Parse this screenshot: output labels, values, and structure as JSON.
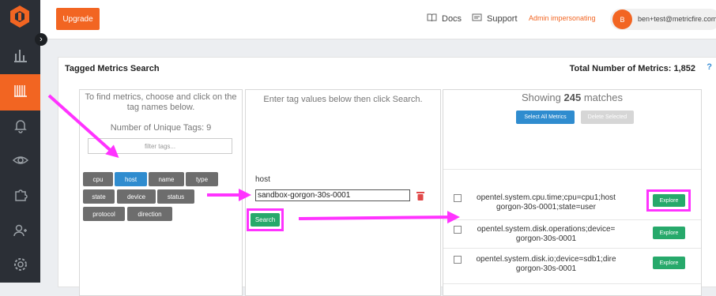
{
  "topbar": {
    "upgrade_label": "Upgrade",
    "docs_label": "Docs",
    "support_label": "Support",
    "impersonating_label": "Admin impersonating",
    "avatar_initial": "B",
    "email": "ben+test@metricfire.com"
  },
  "sidebar": {
    "items": [
      "logo-icon",
      "bar-chart-icon",
      "metrics-icon",
      "bell-icon",
      "eye-icon",
      "puzzle-icon",
      "users-icon",
      "gear-icon"
    ],
    "active_index": 2
  },
  "page": {
    "title": "Tagged Metrics Search",
    "total_label": "Total Number of Metrics: 1,852",
    "help": "?"
  },
  "tags_panel": {
    "instruction_line1": "To find metrics, choose and click on the",
    "instruction_line2": "tag names below.",
    "unique_label": "Number of Unique Tags: 9",
    "filter_placeholder": "filter tags...",
    "tags": [
      {
        "label": "cpu",
        "selected": false
      },
      {
        "label": "host",
        "selected": true
      },
      {
        "label": "name",
        "selected": false
      },
      {
        "label": "type",
        "selected": false
      },
      {
        "label": "state",
        "selected": false
      },
      {
        "label": "device",
        "selected": false
      },
      {
        "label": "status",
        "selected": false
      },
      {
        "label": "protocol",
        "selected": false
      },
      {
        "label": "direction",
        "selected": false
      }
    ]
  },
  "values_panel": {
    "instruction": "Enter tag values below then click Search.",
    "host_label": "host",
    "host_value": "sandbox-gorgon-30s-0001",
    "search_label": "Search"
  },
  "results_panel": {
    "showing_prefix": "Showing",
    "count": "245",
    "showing_suffix": "matches",
    "select_all_label": "Select All Metrics",
    "delete_selected_label": "Delete Selected",
    "rows": [
      {
        "line1": "opentel.system.cpu.time;cpu=cpu1;host",
        "line2": "gorgon-30s-0001;state=user",
        "action": "Explore"
      },
      {
        "line1": "opentel.system.disk.operations;device=",
        "line2": "gorgon-30s-0001",
        "action": "Explore"
      },
      {
        "line1": "opentel.system.disk.io;device=sdb1;dire",
        "line2": "gorgon-30s-0001",
        "action": "Explore"
      }
    ]
  },
  "colors": {
    "accent": "#f26522",
    "primary_blue": "#2f8ccf",
    "success_green": "#27a96b",
    "highlight_magenta": "#ff33ff",
    "sidebar_bg": "#2b2f36"
  }
}
